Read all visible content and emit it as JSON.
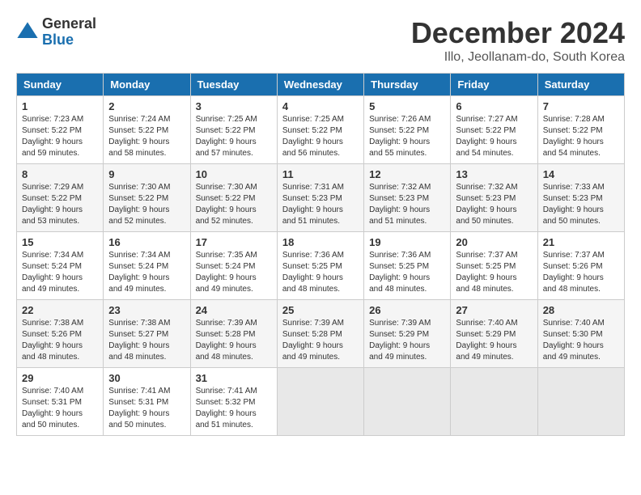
{
  "header": {
    "logo_general": "General",
    "logo_blue": "Blue",
    "main_title": "December 2024",
    "subtitle": "Illo, Jeollanam-do, South Korea"
  },
  "days_of_week": [
    "Sunday",
    "Monday",
    "Tuesday",
    "Wednesday",
    "Thursday",
    "Friday",
    "Saturday"
  ],
  "weeks": [
    [
      {
        "day": "1",
        "sunrise": "7:23 AM",
        "sunset": "5:22 PM",
        "daylight": "9 hours and 59 minutes."
      },
      {
        "day": "2",
        "sunrise": "7:24 AM",
        "sunset": "5:22 PM",
        "daylight": "9 hours and 58 minutes."
      },
      {
        "day": "3",
        "sunrise": "7:25 AM",
        "sunset": "5:22 PM",
        "daylight": "9 hours and 57 minutes."
      },
      {
        "day": "4",
        "sunrise": "7:25 AM",
        "sunset": "5:22 PM",
        "daylight": "9 hours and 56 minutes."
      },
      {
        "day": "5",
        "sunrise": "7:26 AM",
        "sunset": "5:22 PM",
        "daylight": "9 hours and 55 minutes."
      },
      {
        "day": "6",
        "sunrise": "7:27 AM",
        "sunset": "5:22 PM",
        "daylight": "9 hours and 54 minutes."
      },
      {
        "day": "7",
        "sunrise": "7:28 AM",
        "sunset": "5:22 PM",
        "daylight": "9 hours and 54 minutes."
      }
    ],
    [
      {
        "day": "8",
        "sunrise": "7:29 AM",
        "sunset": "5:22 PM",
        "daylight": "9 hours and 53 minutes."
      },
      {
        "day": "9",
        "sunrise": "7:30 AM",
        "sunset": "5:22 PM",
        "daylight": "9 hours and 52 minutes."
      },
      {
        "day": "10",
        "sunrise": "7:30 AM",
        "sunset": "5:22 PM",
        "daylight": "9 hours and 52 minutes."
      },
      {
        "day": "11",
        "sunrise": "7:31 AM",
        "sunset": "5:23 PM",
        "daylight": "9 hours and 51 minutes."
      },
      {
        "day": "12",
        "sunrise": "7:32 AM",
        "sunset": "5:23 PM",
        "daylight": "9 hours and 51 minutes."
      },
      {
        "day": "13",
        "sunrise": "7:32 AM",
        "sunset": "5:23 PM",
        "daylight": "9 hours and 50 minutes."
      },
      {
        "day": "14",
        "sunrise": "7:33 AM",
        "sunset": "5:23 PM",
        "daylight": "9 hours and 50 minutes."
      }
    ],
    [
      {
        "day": "15",
        "sunrise": "7:34 AM",
        "sunset": "5:24 PM",
        "daylight": "9 hours and 49 minutes."
      },
      {
        "day": "16",
        "sunrise": "7:34 AM",
        "sunset": "5:24 PM",
        "daylight": "9 hours and 49 minutes."
      },
      {
        "day": "17",
        "sunrise": "7:35 AM",
        "sunset": "5:24 PM",
        "daylight": "9 hours and 49 minutes."
      },
      {
        "day": "18",
        "sunrise": "7:36 AM",
        "sunset": "5:25 PM",
        "daylight": "9 hours and 48 minutes."
      },
      {
        "day": "19",
        "sunrise": "7:36 AM",
        "sunset": "5:25 PM",
        "daylight": "9 hours and 48 minutes."
      },
      {
        "day": "20",
        "sunrise": "7:37 AM",
        "sunset": "5:25 PM",
        "daylight": "9 hours and 48 minutes."
      },
      {
        "day": "21",
        "sunrise": "7:37 AM",
        "sunset": "5:26 PM",
        "daylight": "9 hours and 48 minutes."
      }
    ],
    [
      {
        "day": "22",
        "sunrise": "7:38 AM",
        "sunset": "5:26 PM",
        "daylight": "9 hours and 48 minutes."
      },
      {
        "day": "23",
        "sunrise": "7:38 AM",
        "sunset": "5:27 PM",
        "daylight": "9 hours and 48 minutes."
      },
      {
        "day": "24",
        "sunrise": "7:39 AM",
        "sunset": "5:28 PM",
        "daylight": "9 hours and 48 minutes."
      },
      {
        "day": "25",
        "sunrise": "7:39 AM",
        "sunset": "5:28 PM",
        "daylight": "9 hours and 49 minutes."
      },
      {
        "day": "26",
        "sunrise": "7:39 AM",
        "sunset": "5:29 PM",
        "daylight": "9 hours and 49 minutes."
      },
      {
        "day": "27",
        "sunrise": "7:40 AM",
        "sunset": "5:29 PM",
        "daylight": "9 hours and 49 minutes."
      },
      {
        "day": "28",
        "sunrise": "7:40 AM",
        "sunset": "5:30 PM",
        "daylight": "9 hours and 49 minutes."
      }
    ],
    [
      {
        "day": "29",
        "sunrise": "7:40 AM",
        "sunset": "5:31 PM",
        "daylight": "9 hours and 50 minutes."
      },
      {
        "day": "30",
        "sunrise": "7:41 AM",
        "sunset": "5:31 PM",
        "daylight": "9 hours and 50 minutes."
      },
      {
        "day": "31",
        "sunrise": "7:41 AM",
        "sunset": "5:32 PM",
        "daylight": "9 hours and 51 minutes."
      },
      null,
      null,
      null,
      null
    ]
  ],
  "labels": {
    "sunrise": "Sunrise:",
    "sunset": "Sunset:",
    "daylight": "Daylight:"
  }
}
